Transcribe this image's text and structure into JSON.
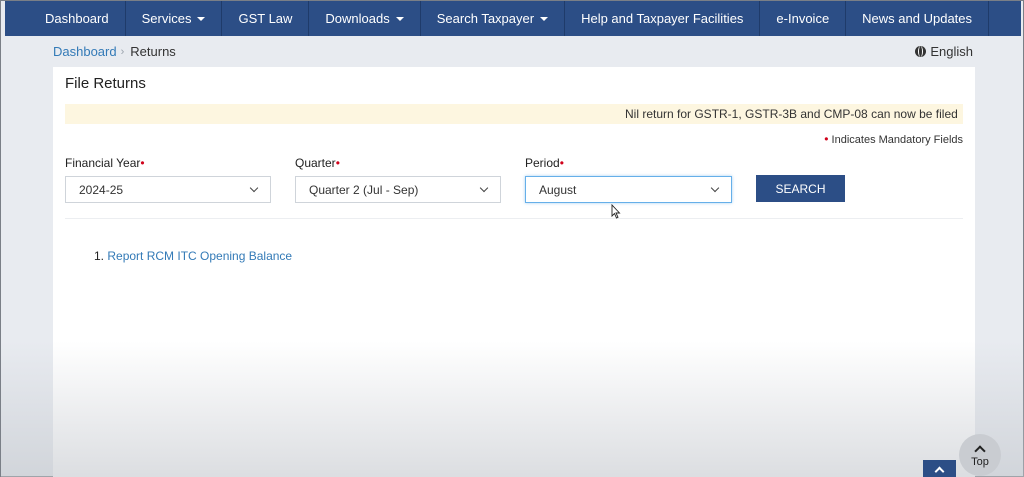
{
  "nav": {
    "items": [
      {
        "label": "Dashboard",
        "dropdown": false
      },
      {
        "label": "Services",
        "dropdown": true
      },
      {
        "label": "GST Law",
        "dropdown": false
      },
      {
        "label": "Downloads",
        "dropdown": true
      },
      {
        "label": "Search Taxpayer",
        "dropdown": true
      },
      {
        "label": "Help and Taxpayer Facilities",
        "dropdown": false
      },
      {
        "label": "e-Invoice",
        "dropdown": false
      },
      {
        "label": "News and Updates",
        "dropdown": false
      }
    ]
  },
  "breadcrumb": {
    "home": "Dashboard",
    "current": "Returns"
  },
  "language": {
    "label": "English",
    "icon": "globe-icon"
  },
  "page": {
    "title": "File Returns",
    "notice": "Nil return for GSTR-1, GSTR-3B and CMP-08 can now be filed",
    "mandatory_note": "Indicates Mandatory Fields",
    "required_mark": "•"
  },
  "form": {
    "financial_year": {
      "label": "Financial Year",
      "value": "2024-25"
    },
    "quarter": {
      "label": "Quarter",
      "value": "Quarter 2 (Jul - Sep)"
    },
    "period": {
      "label": "Period",
      "value": "August"
    },
    "search_label": "SEARCH"
  },
  "links": [
    {
      "number": "1.",
      "label": "Report RCM ITC Opening Balance"
    }
  ],
  "top_button": {
    "label": "Top"
  },
  "colors": {
    "nav_bg": "#2c4e86",
    "link": "#337ab7",
    "required": "#d0021b",
    "notice_bg": "#fdf6e0"
  }
}
